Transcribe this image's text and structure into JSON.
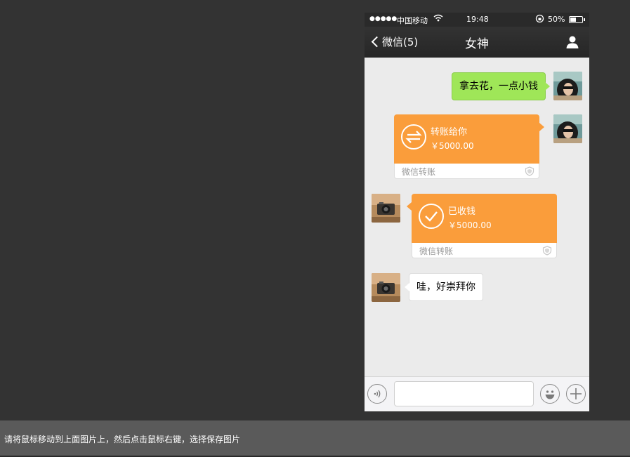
{
  "status_bar": {
    "signal": "●●●●●",
    "carrier": "中国移动",
    "time": "19:48",
    "battery_percent": "50%",
    "battery_level": 0.5
  },
  "nav": {
    "back_label": "微信(5)",
    "title": "女神"
  },
  "messages": {
    "sent_text": "拿去花，一点小钱",
    "sent_transfer": {
      "title": "转账给你",
      "amount": "￥5000.00",
      "footer": "微信转账"
    },
    "received_transfer": {
      "title": "已收钱",
      "amount": "￥5000.00",
      "footer": "微信转账"
    },
    "received_text": "哇，好崇拜你"
  },
  "input_bar": {
    "value": "",
    "placeholder": ""
  },
  "footer": {
    "hint": "请将鼠标移动到上面图片上，然后点击鼠标右键，选择保存图片"
  },
  "colors": {
    "accent_orange": "#fa9d3b",
    "bubble_green": "#9fe658",
    "nav_bg": "#2d2d2d",
    "chat_bg": "#ebebeb"
  }
}
